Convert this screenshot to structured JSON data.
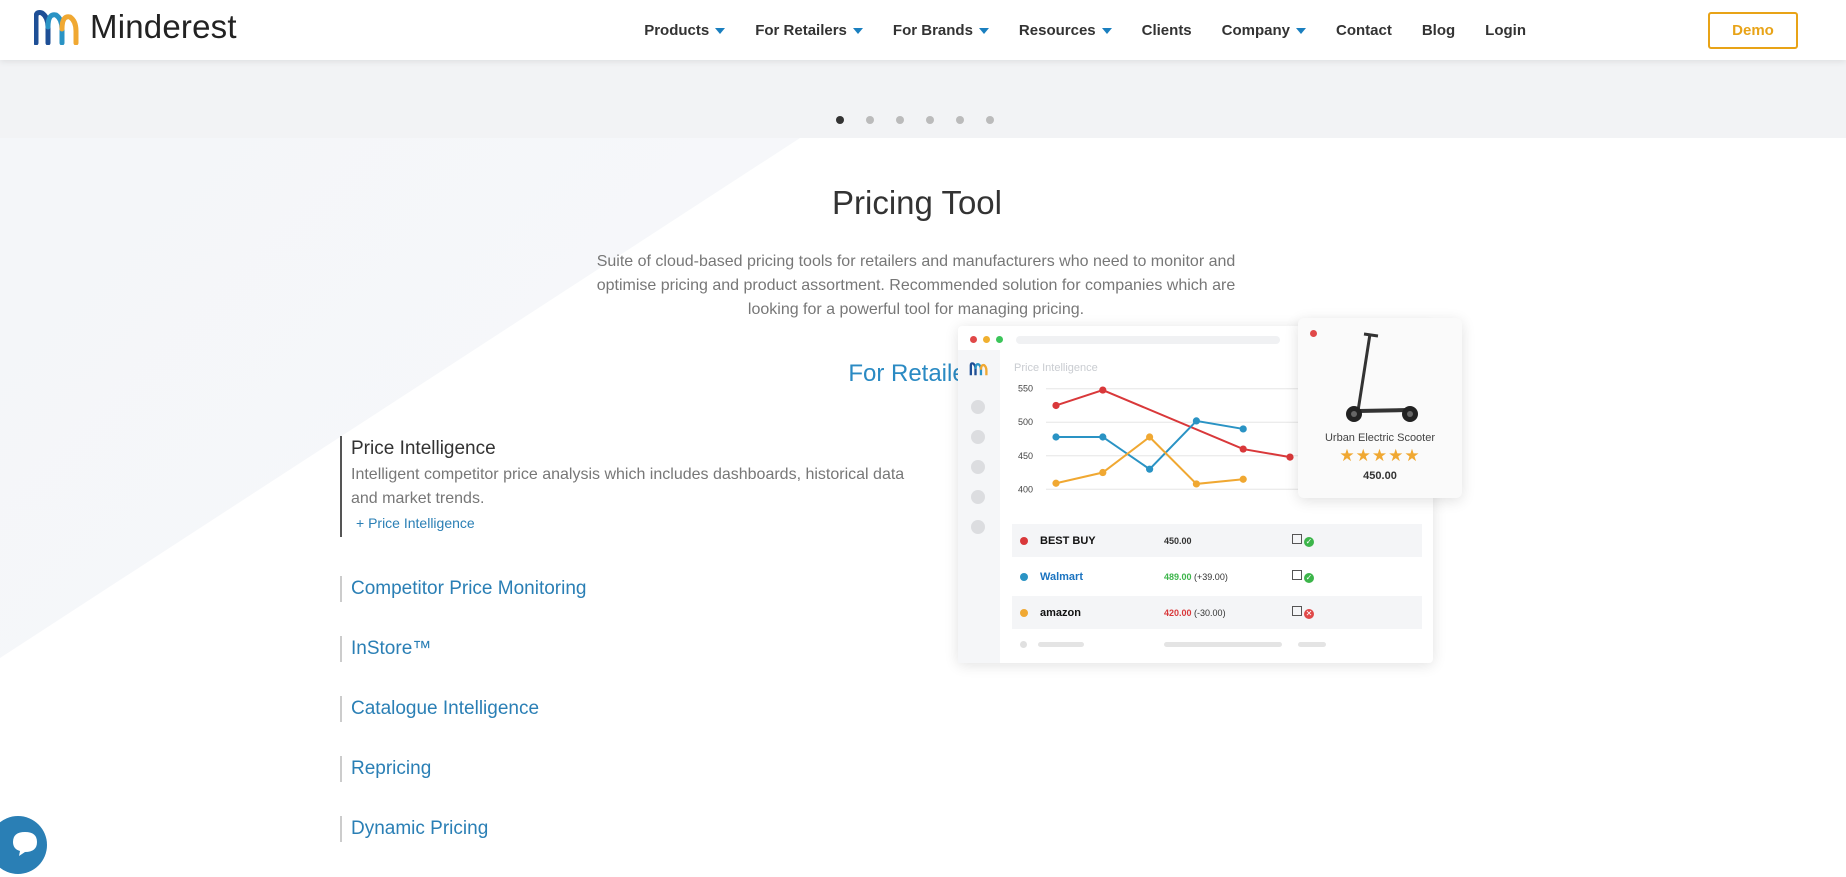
{
  "brand": {
    "name": "Minderest"
  },
  "nav": {
    "items": [
      {
        "label": "Products",
        "dropdown": true
      },
      {
        "label": "For Retailers",
        "dropdown": true
      },
      {
        "label": "For Brands",
        "dropdown": true
      },
      {
        "label": "Resources",
        "dropdown": true
      },
      {
        "label": "Clients",
        "dropdown": false
      },
      {
        "label": "Company",
        "dropdown": true
      },
      {
        "label": "Contact",
        "dropdown": false
      },
      {
        "label": "Blog",
        "dropdown": false
      },
      {
        "label": "Login",
        "dropdown": false
      }
    ],
    "demo_label": "Demo"
  },
  "carousel": {
    "count": 6,
    "active": 0
  },
  "hero": {
    "title": "Pricing Tool",
    "subtitle": "Suite of cloud-based pricing tools for retailers and manufacturers who need to monitor and optimise pricing and product assortment. Recommended solution for companies which are looking for a powerful tool for managing pricing.",
    "section": "For Retailers"
  },
  "features": [
    {
      "title": "Price Intelligence",
      "desc": "Intelligent competitor price analysis which includes dashboards, historical data and market trends.",
      "link": "+ Price Intelligence",
      "active": true
    },
    {
      "title": "Competitor Price Monitoring"
    },
    {
      "title": "InStore™"
    },
    {
      "title": "Catalogue Intelligence"
    },
    {
      "title": "Repricing"
    },
    {
      "title": "Dynamic Pricing"
    }
  ],
  "illustration": {
    "label": "Price Intelligence",
    "chart_data": {
      "type": "line",
      "ylim": [
        390,
        560
      ],
      "yticks": [
        550,
        500,
        450,
        400
      ],
      "x": [
        1,
        2,
        3,
        4,
        5,
        6
      ],
      "series": [
        {
          "color": "#d9383a",
          "values": [
            525,
            548,
            null,
            null,
            460,
            448
          ]
        },
        {
          "color": "#2a93c4",
          "values": [
            478,
            478,
            430,
            502,
            490,
            null
          ]
        },
        {
          "color": "#f0a832",
          "values": [
            409,
            425,
            478,
            408,
            415,
            null
          ]
        }
      ]
    },
    "rows": [
      {
        "brand": "BEST BUY",
        "color": "#d9383a",
        "price": "450.00",
        "change": "",
        "ok": true
      },
      {
        "brand": "Walmart",
        "color": "#2a93c4",
        "price": "489.00",
        "change": "(+39.00)",
        "ok": true
      },
      {
        "brand": "amazon",
        "color": "#f0a832",
        "price": "420.00",
        "change": "(-30.00)",
        "ok": false
      }
    ],
    "card": {
      "name": "Urban Electric Scooter",
      "stars": "★★★★★",
      "price": "450.00"
    }
  }
}
